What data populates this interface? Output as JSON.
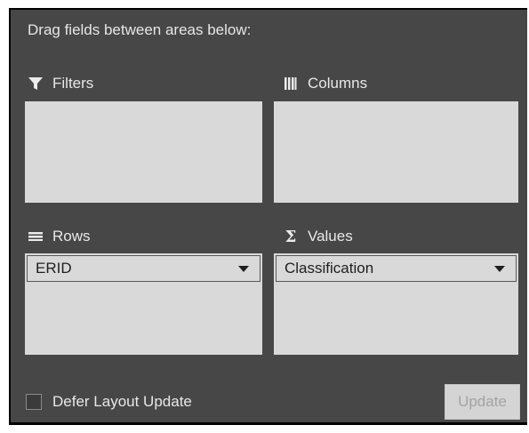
{
  "instructions": "Drag fields between areas below:",
  "areas": {
    "filters": {
      "label": "Filters",
      "icon": "filter-icon",
      "fields": []
    },
    "columns": {
      "label": "Columns",
      "icon": "columns-icon",
      "fields": []
    },
    "rows": {
      "label": "Rows",
      "icon": "rows-icon",
      "fields": [
        "ERID"
      ]
    },
    "values": {
      "label": "Values",
      "icon": "sigma-icon",
      "fields": [
        "Classification"
      ]
    }
  },
  "footer": {
    "defer_label": "Defer Layout Update",
    "defer_checked": false,
    "update_label": "Update",
    "update_enabled": false
  },
  "colors": {
    "panel_bg": "#474747",
    "drop_area_bg": "#d9d9d9",
    "label_text": "#e8e8e8"
  }
}
